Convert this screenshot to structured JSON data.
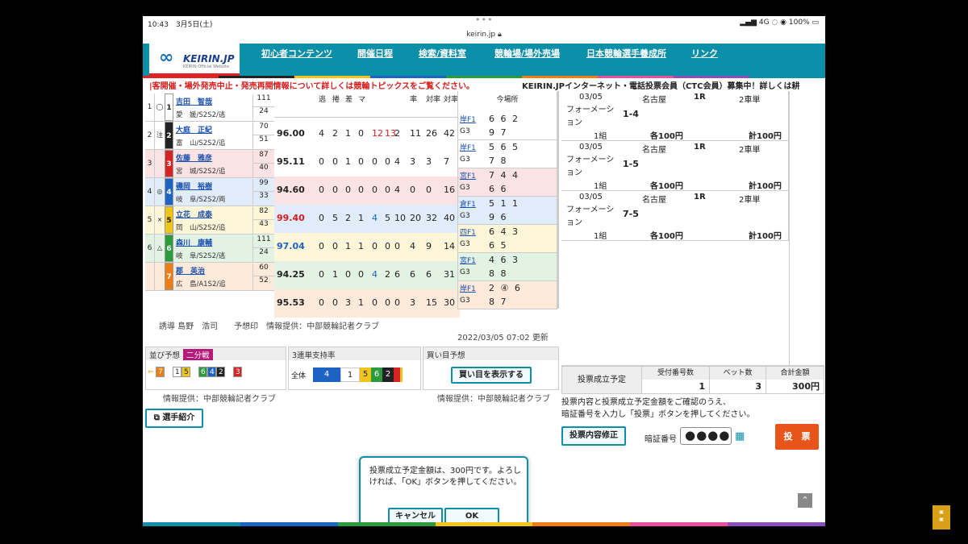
{
  "status": {
    "time": "10:43",
    "date": "3月5日(土)",
    "signal": "4G",
    "battery": "100%"
  },
  "url": "keirin.jp",
  "logo": {
    "mark": "∞",
    "text": "KEIRIN.JP",
    "sub": "KEIRIN Official Website"
  },
  "nav": [
    "初心者コンテンツ",
    "開催日程",
    "検索/資料室",
    "競輪場/場外売場",
    "日本競輪選手養成所",
    "リンク"
  ],
  "ticker": {
    "alert": "|客開催・場外発売中止・発売再開情報について詳しくは競輪トピックスをご覧ください。",
    "promo": "KEIRIN.JPインターネット・電話投票会員（CTC会員）募集中！詳しくは耕"
  },
  "stats_header": [
    "逃",
    "捲",
    "差",
    "マ",
    "",
    "",
    "",
    "率",
    "対率",
    "対率"
  ],
  "venue_header": "今場所",
  "riders": [
    {
      "no": "1",
      "mark": "◯",
      "car": "1",
      "name": "吉田　智哉",
      "pref": "愛　媛/S2S2/逃",
      "n1": "111",
      "n2": "24",
      "color": "#ffffff",
      "row": "#ffffff"
    },
    {
      "no": "2",
      "mark": "注",
      "car": "2",
      "name": "大庭　正紀",
      "pref": "富　山/S2S2/追",
      "n1": "70",
      "n2": "51",
      "color": "#222222",
      "row": "#ffffff"
    },
    {
      "no": "3",
      "mark": "",
      "car": "3",
      "name": "佐藤　雅彦",
      "pref": "宮　城/S2S2/追",
      "n1": "87",
      "n2": "40",
      "color": "#d62424",
      "row": "#fbe3e3"
    },
    {
      "no": "4",
      "mark": "◎",
      "car": "4",
      "name": "磯岡　裕樹",
      "pref": "岐　阜/S2S2/両",
      "n1": "99",
      "n2": "33",
      "color": "#1d63c4",
      "row": "#e1ecfa"
    },
    {
      "no": "5",
      "mark": "×",
      "car": "5",
      "name": "立花　成泰",
      "pref": "岡　山/S2S2/追",
      "n1": "82",
      "n2": "43",
      "color": "#f0c419",
      "row": "#fdf6d8"
    },
    {
      "no": "6",
      "mark": "△",
      "car": "6",
      "name": "森川　康輔",
      "pref": "岐　阜/S2S2/逃",
      "n1": "111",
      "n2": "24",
      "color": "#2b9b3c",
      "row": "#e2f3e3"
    },
    {
      "no": "",
      "mark": "",
      "car": "7",
      "name": "郡　英治",
      "pref": "広　島/A1S2/追",
      "n1": "60",
      "n2": "52",
      "color": "#ee7d16",
      "row": "#fdeadb"
    }
  ],
  "stats": [
    {
      "score": "96.00",
      "v": [
        "4",
        "2",
        "1",
        "0",
        "12",
        "13",
        "2",
        "11",
        "26",
        "42"
      ],
      "red": [
        4,
        5
      ],
      "blue": []
    },
    {
      "score": "95.11",
      "v": [
        "0",
        "0",
        "1",
        "0",
        "0",
        "0",
        "4",
        "3",
        "3",
        "7"
      ],
      "red": [],
      "blue": []
    },
    {
      "score": "94.60",
      "v": [
        "0",
        "0",
        "0",
        "0",
        "0",
        "0",
        "4",
        "0",
        "0",
        "16"
      ],
      "red": [],
      "blue": []
    },
    {
      "score": "99.40",
      "v": [
        "0",
        "5",
        "2",
        "1",
        "4",
        "5",
        "10",
        "20",
        "32",
        "40"
      ],
      "red": [],
      "blue": [
        4
      ]
    },
    {
      "score": "97.04",
      "v": [
        "0",
        "0",
        "1",
        "1",
        "0",
        "0",
        "0",
        "4",
        "9",
        "14"
      ],
      "red": [],
      "blue": []
    },
    {
      "score": "94.25",
      "v": [
        "0",
        "1",
        "0",
        "0",
        "4",
        "2",
        "6",
        "6",
        "6",
        "31"
      ],
      "red": [],
      "blue": [
        4
      ]
    },
    {
      "score": "95.53",
      "v": [
        "0",
        "0",
        "3",
        "1",
        "0",
        "0",
        "0",
        "3",
        "15",
        "30"
      ],
      "red": [],
      "blue": []
    }
  ],
  "venue": [
    {
      "t": "岸F1",
      "tv": "6 6 2",
      "g": "G3",
      "gv": "9 7"
    },
    {
      "t": "岸F1",
      "tv": "5 6 5",
      "g": "G3",
      "gv": "7 8"
    },
    {
      "t": "宮F1",
      "tv": "7 4 4",
      "g": "G3",
      "gv": "6 6"
    },
    {
      "t": "倉F1",
      "tv": "5 1 1",
      "g": "G3",
      "gv": "9 6"
    },
    {
      "t": "四F1",
      "tv": "6 4 3",
      "g": "G3",
      "gv": "6 5"
    },
    {
      "t": "宮F1",
      "tv": "4 6 3",
      "g": "G3",
      "gv": "8 8"
    },
    {
      "t": "岸F1",
      "tv": "2 ④ 6",
      "g": "G3",
      "gv": "8 7"
    }
  ],
  "leftfoot": "誘導 島野　浩司　　予想印　情報提供：中部競輪記者クラブ",
  "updated": "2022/03/05 07:02 更新",
  "panels": {
    "p1_title": "並び予想",
    "p1_tag": "二分戦",
    "p1_line": [
      "7",
      "1",
      "5",
      "6",
      "4",
      "2",
      "3"
    ],
    "p2_title": "3連単支持率",
    "p2_label": "全体",
    "p3_title": "買い目予想",
    "p3_btn": "買い目を表示する"
  },
  "source": "情報提供：中部競輪記者クラブ",
  "intro_btn": "選手紹介",
  "bets": [
    {
      "date": "03/05",
      "venue": "名古屋",
      "race": "1R",
      "kind": "2車単",
      "type": "フォーメーション",
      "combo": "1-4",
      "units": "1組",
      "each": "各100円",
      "total": "計100円"
    },
    {
      "date": "03/05",
      "venue": "名古屋",
      "race": "1R",
      "kind": "2車単",
      "type": "フォーメーション",
      "combo": "1-5",
      "units": "1組",
      "each": "各100円",
      "total": "計100円"
    },
    {
      "date": "03/05",
      "venue": "名古屋",
      "race": "1R",
      "kind": "2車単",
      "type": "フォーメーション",
      "combo": "7-5",
      "units": "1組",
      "each": "各100円",
      "total": "計100円"
    }
  ],
  "summary": {
    "label": "投票成立予定",
    "h1": "受付番号数",
    "v1": "1",
    "h2": "ベット数",
    "v2": "3",
    "h3": "合計金額",
    "v3": "300円"
  },
  "notice": [
    "投票内容と投票成立予定金額をご確認のうえ、",
    "暗証番号を入力し「投票」ボタンを押してください。"
  ],
  "fix_btn": "投票内容修正",
  "pin_label": "暗証番号",
  "pin_value": "●●●●",
  "vote_btn": "投　票",
  "dialog": {
    "msg": "投票成立予定金額は、300円です。よろしければ、「OK」ボタンを押してください。",
    "cancel": "キャンセル",
    "ok": "OK"
  },
  "colors": {
    "accent": "#0c8fa8",
    "vote": "#e8551a"
  }
}
